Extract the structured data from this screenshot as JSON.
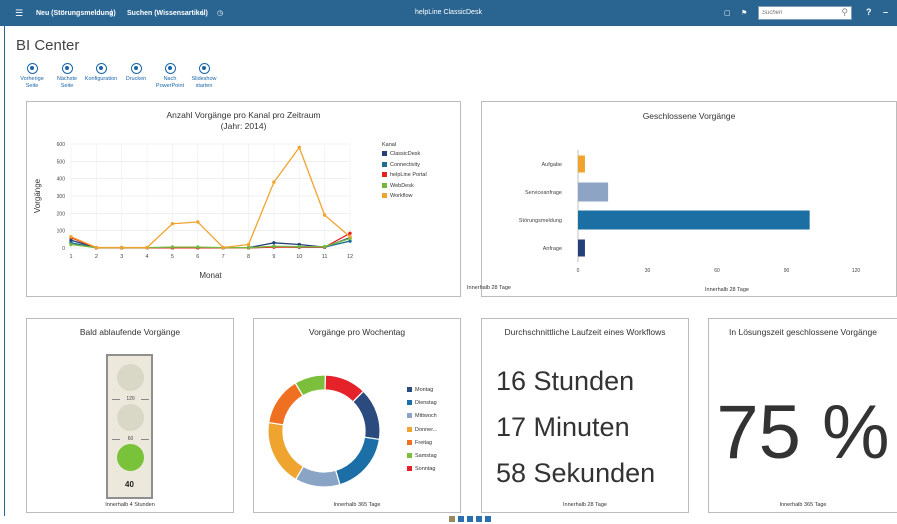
{
  "topbar": {
    "menu_icon": "hamburger-menu-icon",
    "new_label": "Neu (Störungsmeldung)",
    "search_label": "Suchen (Wissensartikel)",
    "title": "helpLine ClassicDesk",
    "search_placeholder": "Suchen",
    "help_label": "?",
    "minimize_label": "–"
  },
  "page_title": "BI Center",
  "toolbar": [
    {
      "icon": "back-arrow-icon",
      "label": "Vorherige\nSeite"
    },
    {
      "icon": "forward-arrow-icon",
      "label": "Nächste\nSeite"
    },
    {
      "icon": "settings-icon",
      "label": "Konfiguration"
    },
    {
      "icon": "print-icon",
      "label": "Drucken"
    },
    {
      "icon": "powerpoint-icon",
      "label": "Nach\nPowerPoint"
    },
    {
      "icon": "play-icon",
      "label": "Slideshow\nstarten"
    }
  ],
  "cards": {
    "channel": {
      "title": "Anzahl Vorgänge pro Kanal pro Zeitraum",
      "subtitle": "(Jahr: 2014)",
      "legend_title": "Kanal"
    },
    "closed": {
      "title": "Geschlossene Vorgänge",
      "footer": "Innerhalb 28 Tage"
    },
    "expiring": {
      "title": "Bald ablaufende Vorgänge",
      "footer": "Innerhalb 4 Stunden",
      "thresholds": [
        "120",
        "60"
      ],
      "value": "40"
    },
    "weekday": {
      "title": "Vorgänge pro Wochentag",
      "footer": "Innerhalb 365 Tage"
    },
    "workflow": {
      "title": "Durchschnittliche Laufzeit eines Workflows",
      "lines": [
        "16 Stunden",
        "17 Minuten",
        "58 Sekunden"
      ],
      "footer": "Innerhalb 28 Tage"
    },
    "solved": {
      "title": "In Lösungszeit geschlossene Vorgänge",
      "value": "75 %",
      "footer": "Innerhalb 365 Tage"
    }
  },
  "chart_data": [
    {
      "type": "line",
      "title": "Anzahl Vorgänge pro Kanal pro Zeitraum",
      "subtitle": "(Jahr: 2014)",
      "xlabel": "Monat",
      "ylabel": "Vorgänge",
      "x": [
        1,
        2,
        3,
        4,
        5,
        6,
        7,
        8,
        9,
        10,
        11,
        12
      ],
      "ylim": [
        0,
        600
      ],
      "yticks": [
        0,
        100,
        200,
        300,
        400,
        500,
        600
      ],
      "legend_title": "Kanal",
      "series": [
        {
          "name": "ClassicDesk",
          "color": "#243f7a",
          "values": [
            45,
            2,
            2,
            2,
            2,
            2,
            2,
            2,
            30,
            20,
            5,
            60
          ]
        },
        {
          "name": "Connectivity",
          "color": "#1b6f8f",
          "values": [
            30,
            1,
            1,
            1,
            1,
            1,
            1,
            1,
            8,
            5,
            5,
            40
          ]
        },
        {
          "name": "helpLine Portal",
          "color": "#e8201f",
          "values": [
            60,
            1,
            1,
            1,
            1,
            1,
            1,
            1,
            5,
            5,
            5,
            85
          ]
        },
        {
          "name": "WebDesk",
          "color": "#73b83c",
          "values": [
            20,
            2,
            2,
            2,
            5,
            5,
            2,
            2,
            10,
            8,
            8,
            55
          ]
        },
        {
          "name": "Workflow",
          "color": "#f0a430",
          "values": [
            65,
            3,
            3,
            3,
            140,
            150,
            3,
            20,
            380,
            580,
            190,
            65
          ]
        }
      ]
    },
    {
      "type": "bar",
      "orientation": "horizontal",
      "title": "Geschlossene Vorgänge",
      "categories": [
        "Aufgabe",
        "Serviceanfrage",
        "Störungsmeldung",
        "Anfrage"
      ],
      "values": [
        3,
        13,
        100,
        3
      ],
      "colors": [
        "#f0a430",
        "#8da4c4",
        "#1b6fa3",
        "#243f7a"
      ],
      "xlim": [
        0,
        120
      ],
      "xticks": [
        0,
        30,
        60,
        90,
        120
      ],
      "xlabel": "Innerhalb 28 Tage"
    },
    {
      "type": "pie",
      "title": "Vorgänge pro Wochentag",
      "donut": true,
      "categories": [
        "Montag",
        "Dienstag",
        "Mittwoch",
        "Donnerstag",
        "Freitag",
        "Samstag",
        "Sonntag"
      ],
      "legend_labels": [
        "Montag",
        "Dienstag",
        "Mittwoch",
        "Donner...",
        "Freitag",
        "Samstag",
        "Sonntag"
      ],
      "values": [
        15,
        18,
        13,
        19,
        14,
        9,
        12
      ],
      "colors": [
        "#2b4a7e",
        "#1c6fa6",
        "#8aa4c6",
        "#f0a430",
        "#f07022",
        "#7bbf3c",
        "#e52129"
      ]
    }
  ]
}
